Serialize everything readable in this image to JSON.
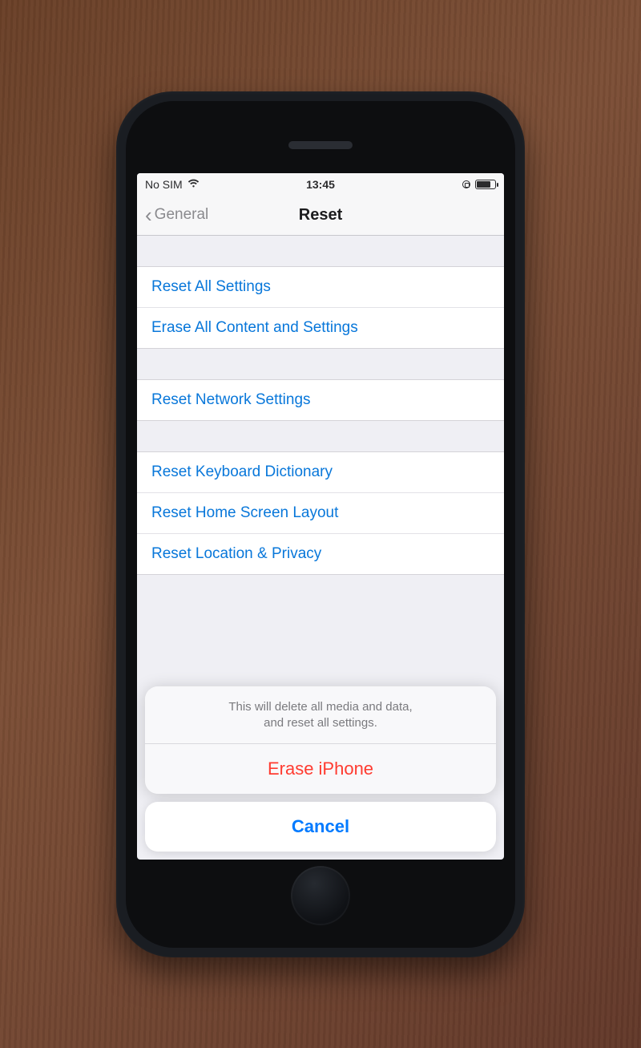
{
  "statusbar": {
    "carrier": "No SIM",
    "time": "13:45"
  },
  "navbar": {
    "back_label": "General",
    "title": "Reset"
  },
  "groups": {
    "g1": {
      "r0": "Reset All Settings",
      "r1": "Erase All Content and Settings"
    },
    "g2": {
      "r0": "Reset Network Settings"
    },
    "g3": {
      "r0": "Reset Keyboard Dictionary",
      "r1": "Reset Home Screen Layout",
      "r2": "Reset Location & Privacy"
    }
  },
  "sheet": {
    "message_line1": "This will delete all media and data,",
    "message_line2": "and reset all settings.",
    "action": "Erase iPhone",
    "cancel": "Cancel"
  }
}
